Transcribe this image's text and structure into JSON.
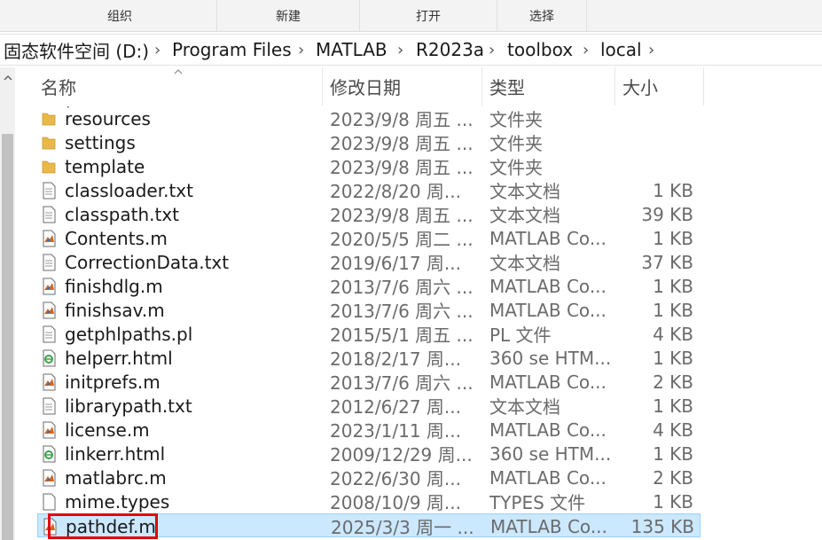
{
  "ribbon": {
    "groups": [
      "组织",
      "新建",
      "打开",
      "选择"
    ]
  },
  "address": {
    "crumbs": [
      "固态软件空间 (D:)",
      "Program Files",
      "MATLAB",
      "R2023a",
      "toolbox",
      "local"
    ],
    "separator": "›"
  },
  "columns": {
    "name": "名称",
    "date": "修改日期",
    "type": "类型",
    "size": "大小"
  },
  "files": [
    {
      "name": "resources",
      "date": "2023/9/8 周五 ...",
      "type": "文件夹",
      "size": "",
      "icon": "folder-icon"
    },
    {
      "name": "settings",
      "date": "2023/9/8 周五 ...",
      "type": "文件夹",
      "size": "",
      "icon": "folder-icon"
    },
    {
      "name": "template",
      "date": "2023/9/8 周五 ...",
      "type": "文件夹",
      "size": "",
      "icon": "folder-icon"
    },
    {
      "name": "classloader.txt",
      "date": "2022/8/20 周...",
      "type": "文本文档",
      "size": "1 KB",
      "icon": "text-file-icon"
    },
    {
      "name": "classpath.txt",
      "date": "2023/9/8 周五 ...",
      "type": "文本文档",
      "size": "39 KB",
      "icon": "text-file-icon"
    },
    {
      "name": "Contents.m",
      "date": "2020/5/5 周二 ...",
      "type": "MATLAB Co...",
      "size": "1 KB",
      "icon": "matlab-file-icon"
    },
    {
      "name": "CorrectionData.txt",
      "date": "2019/6/17 周...",
      "type": "文本文档",
      "size": "37 KB",
      "icon": "text-file-icon"
    },
    {
      "name": "finishdlg.m",
      "date": "2013/7/6 周六 ...",
      "type": "MATLAB Co...",
      "size": "1 KB",
      "icon": "matlab-file-icon"
    },
    {
      "name": "finishsav.m",
      "date": "2013/7/6 周六 ...",
      "type": "MATLAB Co...",
      "size": "1 KB",
      "icon": "matlab-file-icon"
    },
    {
      "name": "getphlpaths.pl",
      "date": "2015/5/1 周五 ...",
      "type": "PL 文件",
      "size": "4 KB",
      "icon": "text-file-icon"
    },
    {
      "name": "helperr.html",
      "date": "2018/2/17 周...",
      "type": "360 se HTM...",
      "size": "1 KB",
      "icon": "browser-html-icon"
    },
    {
      "name": "initprefs.m",
      "date": "2013/7/6 周六 ...",
      "type": "MATLAB Co...",
      "size": "2 KB",
      "icon": "matlab-file-icon"
    },
    {
      "name": "librarypath.txt",
      "date": "2012/6/27 周...",
      "type": "文本文档",
      "size": "1 KB",
      "icon": "text-file-icon"
    },
    {
      "name": "license.m",
      "date": "2023/1/11 周...",
      "type": "MATLAB Co...",
      "size": "4 KB",
      "icon": "matlab-file-icon"
    },
    {
      "name": "linkerr.html",
      "date": "2009/12/29 周...",
      "type": "360 se HTM...",
      "size": "1 KB",
      "icon": "browser-html-icon"
    },
    {
      "name": "matlabrc.m",
      "date": "2022/6/30 周...",
      "type": "MATLAB Co...",
      "size": "2 KB",
      "icon": "matlab-file-icon"
    },
    {
      "name": "mime.types",
      "date": "2008/10/9 周...",
      "type": "TYPES 文件",
      "size": "1 KB",
      "icon": "blank-file-icon"
    },
    {
      "name": "pathdef.m",
      "date": "2025/3/3 周一 ...",
      "type": "MATLAB Co...",
      "size": "135 KB",
      "icon": "matlab-file-icon",
      "selected": true
    }
  ],
  "colors": {
    "selection_bg": "#cce8ff",
    "selection_border": "#99d1ff",
    "highlight": "#e60000",
    "folder": "#e8b84a"
  }
}
